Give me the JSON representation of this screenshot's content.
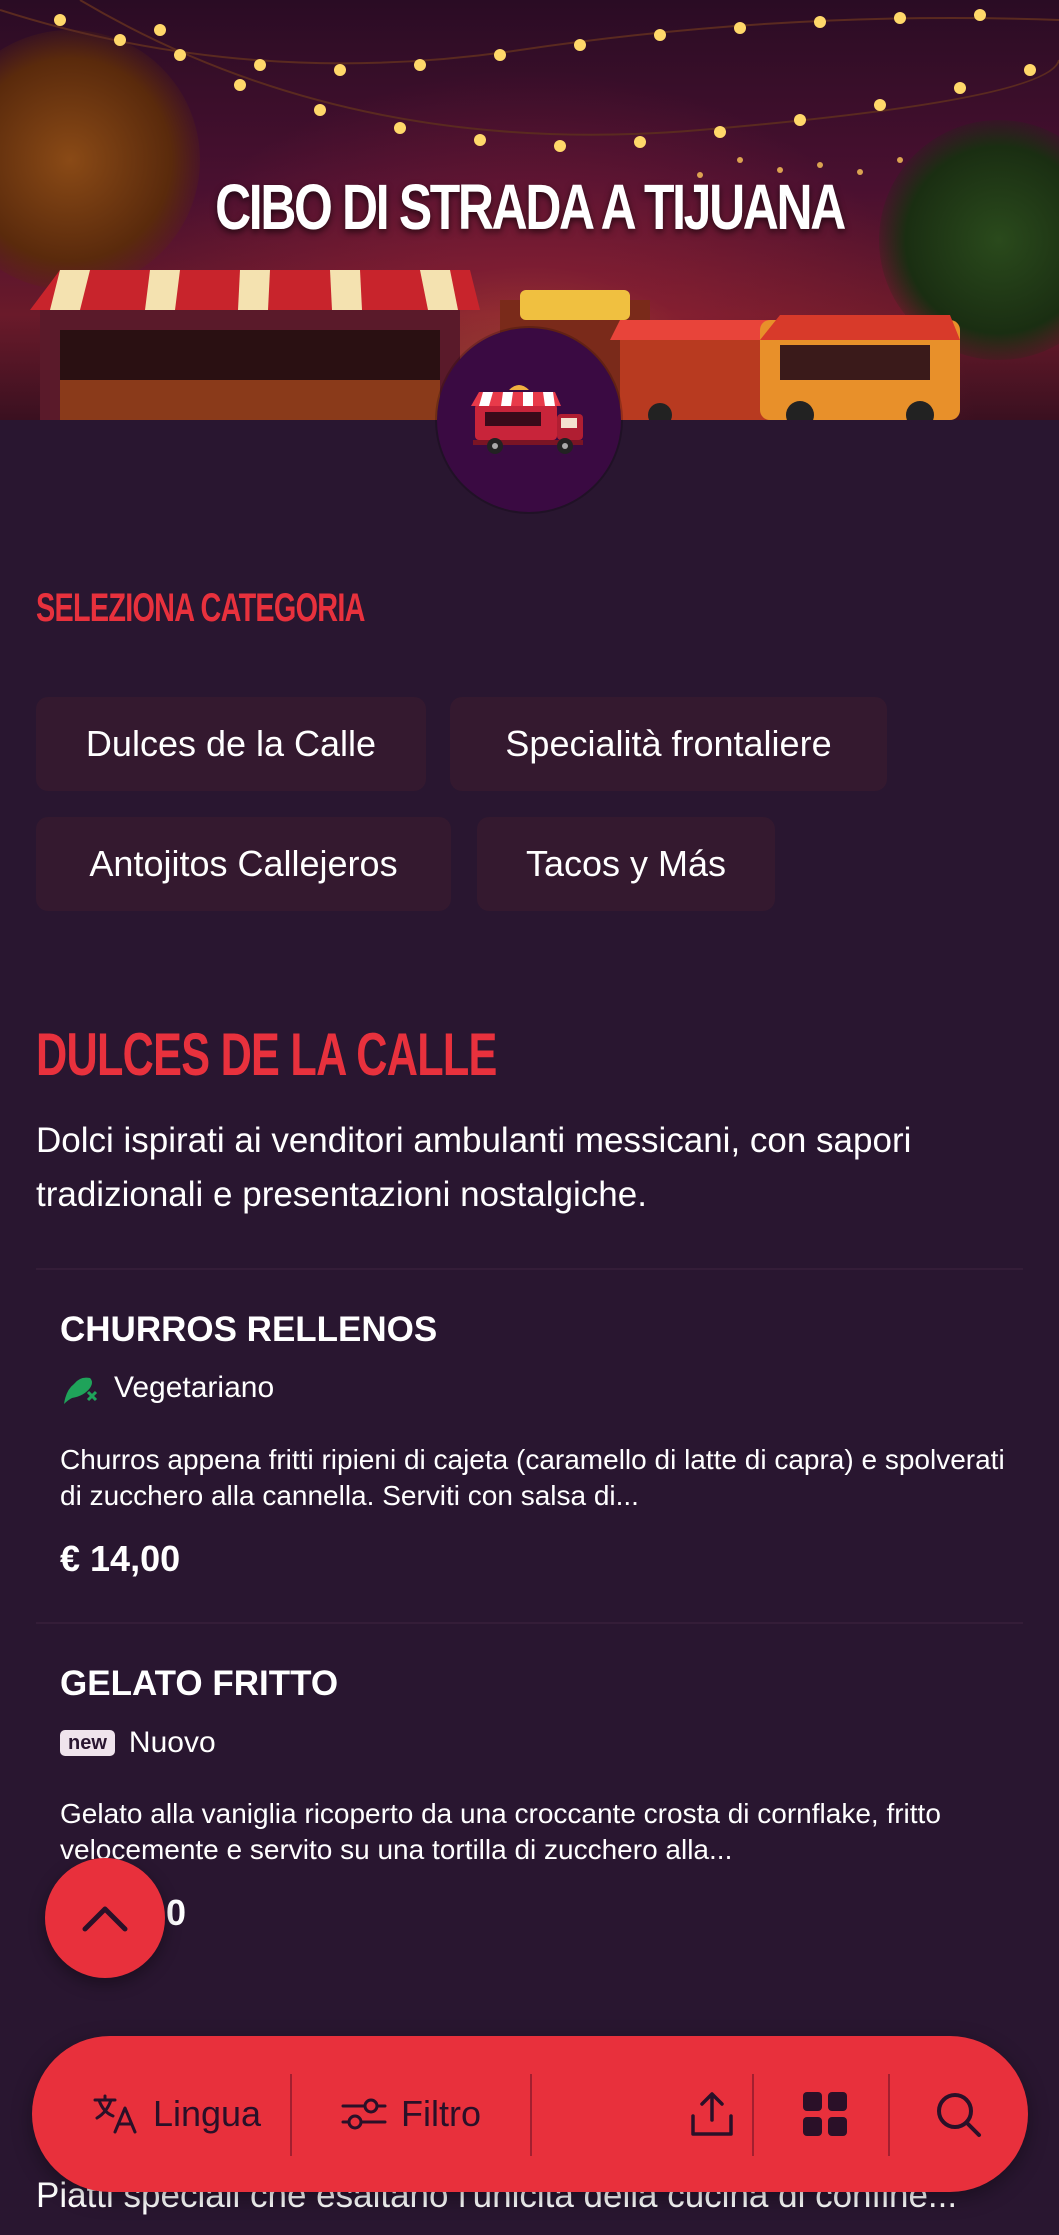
{
  "hero": {
    "title": "CIBO DI STRADA A TIJUANA"
  },
  "categories": {
    "label": "SELEZIONA CATEGORIA",
    "chips": [
      "Dulces de la Calle",
      "Specialità frontaliere",
      "Antojitos Callejeros",
      "Tacos y Más"
    ]
  },
  "current_category": {
    "title": "DULCES DE LA CALLE",
    "description": "Dolci ispirati ai venditori ambulanti messicani, con sapori tradizionali e presentazioni nostalgiche."
  },
  "items": [
    {
      "name": "CHURROS RELLENOS",
      "tag": "Vegetariano",
      "tag_icon": "vegetarian-icon",
      "description": "Churros appena fritti ripieni di cajeta (caramello di latte di capra) e spolverati di zucchero alla cannella. Serviti con salsa di...",
      "price": "€ 14,00"
    },
    {
      "name": "GELATO FRITTO",
      "badge": "new",
      "tag": "Nuovo",
      "description": "Gelato alla vaniglia ricoperto da una croccante crosta di cornflake, fritto velocemente e servito su una tortilla di zucchero alla...",
      "price_visible": "0"
    }
  ],
  "next_category_desc": "Piatti speciali che esaltano l'unicità della cucina di confine...",
  "bottom_bar": {
    "language_label": "Lingua",
    "filter_label": "Filtro",
    "icons": [
      "translate-icon",
      "filter-icon",
      "share-icon",
      "grid-icon",
      "search-icon"
    ]
  },
  "colors": {
    "accent": "#e8303c",
    "background": "#291630",
    "chip": "#34192f",
    "vegetarian": "#1fa35a"
  }
}
